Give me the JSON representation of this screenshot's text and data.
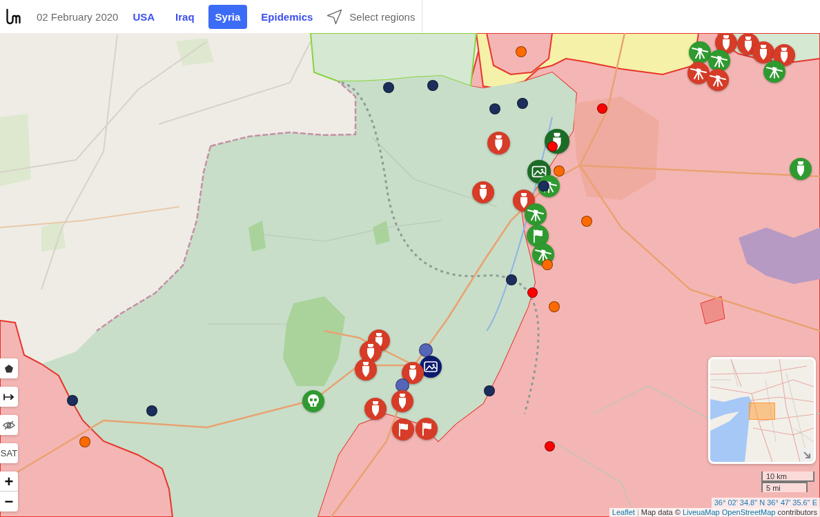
{
  "header": {
    "date": "02 February 2020",
    "tabs": [
      {
        "label": "USA",
        "selected": false
      },
      {
        "label": "Iraq",
        "selected": false
      },
      {
        "label": "Syria",
        "selected": true
      },
      {
        "label": "Epidemics",
        "selected": false
      }
    ],
    "select_regions": "Select regions"
  },
  "map": {
    "markers": [
      {
        "kind": "bomb",
        "color": "#d63c27"
      },
      {
        "kind": "bomb",
        "color": "#d63c27"
      },
      {
        "kind": "gun",
        "color": "#2f9a2f"
      },
      {
        "kind": "gun",
        "color": "#2f9a2f"
      },
      {
        "kind": "gun",
        "color": "#d63c27"
      },
      {
        "kind": "gun",
        "color": "#d63c27"
      },
      {
        "kind": "bomb",
        "color": "#d63c27"
      },
      {
        "kind": "bomb",
        "color": "#d63c27"
      },
      {
        "kind": "gun",
        "color": "#2f9a2f"
      },
      {
        "kind": "dot",
        "color": "#ff6a00"
      },
      {
        "kind": "dot",
        "color": "#1c2e5c"
      },
      {
        "kind": "dot",
        "color": "#1c2e5c"
      },
      {
        "kind": "dot",
        "color": "#1c2e5c"
      },
      {
        "kind": "dot",
        "color": "#1c2e5c"
      },
      {
        "kind": "dot",
        "color": "#ff0000"
      },
      {
        "kind": "bomb",
        "color": "#d63c27"
      },
      {
        "kind": "bomb",
        "color": "#1c6b27"
      },
      {
        "kind": "dot",
        "color": "#ff0000"
      },
      {
        "kind": "bomb",
        "color": "#2f9a2f"
      },
      {
        "kind": "photo",
        "color": "#1c6b27"
      },
      {
        "kind": "dot",
        "color": "#ff6a00"
      },
      {
        "kind": "gun",
        "color": "#2f9a2f"
      },
      {
        "kind": "dot",
        "color": "#1c2e5c"
      },
      {
        "kind": "bomb",
        "color": "#d63c27"
      },
      {
        "kind": "bomb",
        "color": "#d63c27"
      },
      {
        "kind": "gun",
        "color": "#2f9a2f"
      },
      {
        "kind": "dot",
        "color": "#ff6a00"
      },
      {
        "kind": "flag",
        "color": "#2f9a2f"
      },
      {
        "kind": "gun",
        "color": "#2f9a2f"
      },
      {
        "kind": "dot",
        "color": "#ff6a00"
      },
      {
        "kind": "dot",
        "color": "#1c2e5c"
      },
      {
        "kind": "dot",
        "color": "#ff0000"
      },
      {
        "kind": "dot",
        "color": "#ff6a00"
      },
      {
        "kind": "bomb",
        "color": "#d63c27"
      },
      {
        "kind": "bomb",
        "color": "#d63c27"
      },
      {
        "kind": "bomb",
        "color": "#d63c27"
      },
      {
        "kind": "dot",
        "color": "#5565b8"
      },
      {
        "kind": "photo",
        "color": "#0d1b6e"
      },
      {
        "kind": "bomb",
        "color": "#d63c27"
      },
      {
        "kind": "dot",
        "color": "#5565b8"
      },
      {
        "kind": "bomb",
        "color": "#d63c27"
      },
      {
        "kind": "bomb",
        "color": "#d63c27"
      },
      {
        "kind": "skull",
        "color": "#2f9a2f"
      },
      {
        "kind": "flag",
        "color": "#d63c27"
      },
      {
        "kind": "flag",
        "color": "#d63c27"
      },
      {
        "kind": "dot",
        "color": "#1c2e5c"
      },
      {
        "kind": "dot",
        "color": "#1c2e5c"
      },
      {
        "kind": "dot",
        "color": "#1c2e5c"
      },
      {
        "kind": "dot",
        "color": "#ff6a00"
      },
      {
        "kind": "dot",
        "color": "#ff0000"
      }
    ],
    "controls": [
      {
        "kind": "polygon"
      },
      {
        "kind": "measure"
      },
      {
        "kind": "hide"
      },
      {
        "kind": "label",
        "label": "SAT"
      }
    ],
    "zoom": [
      "+",
      "−"
    ],
    "scale": [
      "10 km",
      "5 mi"
    ],
    "coordinates": "36° 02' 34.8\" N 36° 47' 35.6\" E",
    "attribution": [
      {
        "kind": "link",
        "text": "Leaflet"
      },
      {
        "kind": "separator",
        "text": "|"
      },
      {
        "kind": "text",
        "text": "Map data ©"
      },
      {
        "kind": "link",
        "text": "LiveuaMap"
      },
      {
        "kind": "link",
        "text": "OpenStreetMap"
      },
      {
        "kind": "text",
        "text": "contributors"
      }
    ]
  }
}
